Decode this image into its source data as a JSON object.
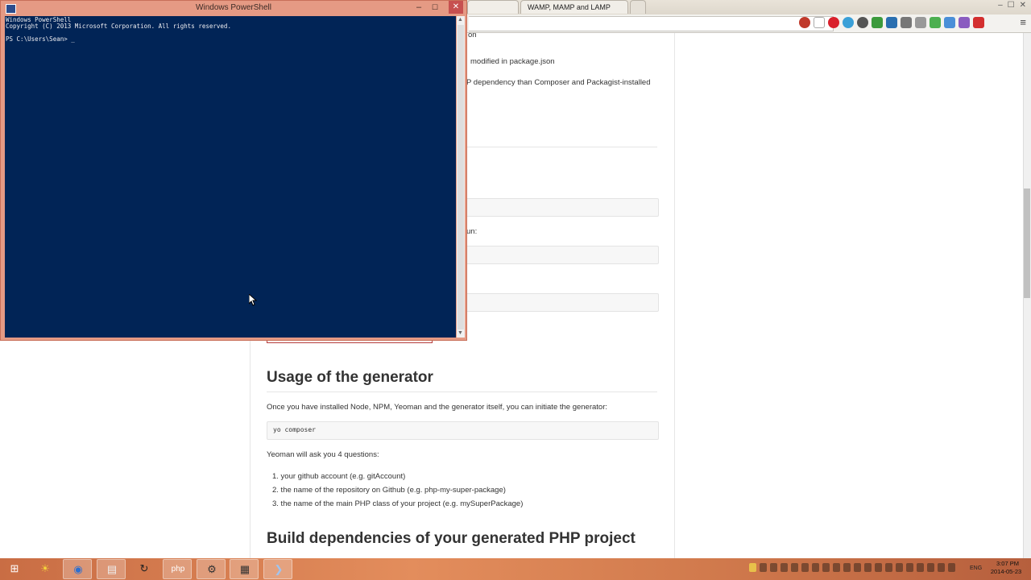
{
  "browser": {
    "tabs": [
      {
        "label": ""
      },
      {
        "label": "WAMP, MAMP and LAMP"
      }
    ],
    "controls": {
      "minimize": "–",
      "maximize": "☐",
      "close": "✕"
    },
    "menu_glyph": "≡",
    "extension_icons": [
      "stop-icon",
      "star-icon",
      "opera-icon",
      "swirl-icon",
      "refresh-icon",
      "gear-icon",
      "v-icon",
      "s-icon",
      "window-icon",
      "evernote-icon",
      "jb-icon",
      "arrow-icon",
      "flag-icon"
    ]
  },
  "page": {
    "partial_lines": [
      "on",
      "modified in package.json",
      "P dependency than Composer and Packagist-installed",
      "un:"
    ],
    "usage_heading": "Usage of the generator",
    "usage_intro": "Once you have installed Node, NPM, Yeoman and the generator itself, you can initiate the generator:",
    "usage_code": "yo composer",
    "questions_intro": "Yeoman will ask you 4 questions:",
    "questions": [
      "1.  your github account (e.g. gitAccount)",
      "2.  the name of the repository on Github (e.g. php-my-super-package)",
      "3.  the name of the main PHP class of your project (e.g. mySuperPackage)"
    ],
    "build_heading": "Build dependencies of your generated PHP project"
  },
  "powershell": {
    "title": "Windows PowerShell",
    "controls": {
      "minimize": "–",
      "maximize": "☐",
      "close": "✕"
    },
    "lines": [
      "Windows PowerShell",
      "Copyright (C) 2013 Microsoft Corporation. All rights reserved.",
      "",
      "PS C:\\Users\\Sean> _"
    ]
  },
  "taskbar": {
    "apps": [
      {
        "name": "windows-start-icon",
        "glyph": "⊞"
      },
      {
        "name": "sun-app-icon",
        "glyph": "☀"
      },
      {
        "name": "browser-app-icon",
        "glyph": "◉"
      },
      {
        "name": "file-explorer-icon",
        "glyph": "▤"
      },
      {
        "name": "sync-app-icon",
        "glyph": "↻"
      },
      {
        "name": "php-app-icon",
        "glyph": "php"
      },
      {
        "name": "tool-app-icon",
        "glyph": "⚙"
      },
      {
        "name": "film-app-icon",
        "glyph": "▦"
      },
      {
        "name": "powershell-app-icon",
        "glyph": "❯"
      }
    ],
    "language": "ENG",
    "time": "3:07 PM",
    "date": "2014-05-23"
  },
  "colors": {
    "console_bg": "#012456",
    "console_text": "#eeedf0",
    "window_frame": "#e59a84",
    "close_red": "#c75050"
  }
}
